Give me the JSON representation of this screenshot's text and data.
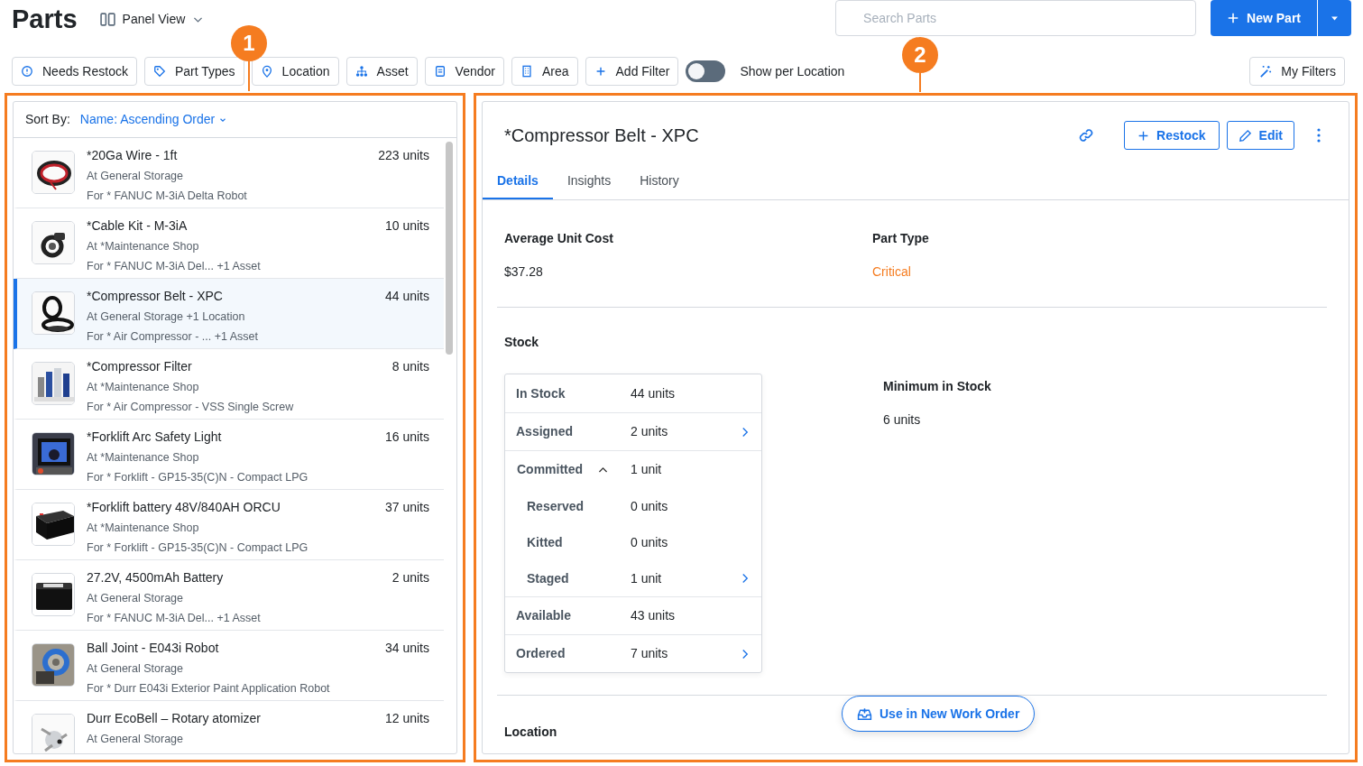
{
  "page": {
    "title": "Parts",
    "view": "Panel View",
    "search": {
      "placeholder": "Search Parts"
    },
    "new_button": "New Part"
  },
  "filters": [
    {
      "label": "Needs Restock",
      "kind": "restock"
    },
    {
      "label": "Part Types",
      "kind": "tag"
    },
    {
      "label": "Location",
      "kind": "pin"
    },
    {
      "label": "Asset",
      "kind": "asset"
    },
    {
      "label": "Vendor",
      "kind": "vendor"
    },
    {
      "label": "Area",
      "kind": "building"
    },
    {
      "label": "Add Filter",
      "kind": "plus"
    }
  ],
  "per_location": {
    "label": "Show per Location",
    "on": false
  },
  "my_filters": "My Filters",
  "sort": {
    "label": "Sort By:",
    "value": "Name: Ascending Order"
  },
  "parts": [
    {
      "name": "*20Ga Wire - 1ft",
      "qty": "223 units",
      "location": "At General Storage",
      "asset": "For * FANUC M-3iA Delta Robot",
      "selected": false
    },
    {
      "name": "*Cable Kit - M-3iA",
      "qty": "10 units",
      "location": "At *Maintenance Shop",
      "asset": "For * FANUC M-3iA Del...  +1 Asset",
      "selected": false
    },
    {
      "name": "*Compressor Belt - XPC",
      "qty": "44 units",
      "location": "At General Storage +1 Location",
      "asset": "For * Air Compressor - ...  +1 Asset",
      "selected": true
    },
    {
      "name": "*Compressor Filter",
      "qty": "8 units",
      "location": "At *Maintenance Shop",
      "asset": "For * Air Compressor - VSS Single Screw",
      "selected": false
    },
    {
      "name": "*Forklift Arc Safety Light",
      "qty": "16 units",
      "location": "At *Maintenance Shop",
      "asset": "For * Forklift - GP15-35(C)N - Compact LPG",
      "selected": false
    },
    {
      "name": "*Forklift battery 48V/840AH ORCU",
      "qty": "37 units",
      "location": "At *Maintenance Shop",
      "asset": "For * Forklift - GP15-35(C)N - Compact LPG",
      "selected": false
    },
    {
      "name": "27.2V, 4500mAh Battery",
      "qty": "2 units",
      "location": "At General Storage",
      "asset": "For * FANUC M-3iA Del...  +1 Asset",
      "selected": false
    },
    {
      "name": "Ball Joint - E043i Robot",
      "qty": "34 units",
      "location": "At General Storage",
      "asset": "For * Durr E043i Exterior Paint Application Robot",
      "selected": false
    },
    {
      "name": "Durr EcoBell – Rotary atomizer",
      "qty": "12 units",
      "location": "At General Storage",
      "selected": false
    }
  ],
  "detail": {
    "title": "*Compressor Belt - XPC",
    "restock": "Restock",
    "edit": "Edit",
    "tabs": [
      {
        "label": "Details",
        "selected": true
      },
      {
        "label": "Insights",
        "selected": false
      },
      {
        "label": "History",
        "selected": false
      }
    ],
    "fields": [
      {
        "label": "Average Unit Cost",
        "value": "$37.28",
        "kind": "plain"
      },
      {
        "label": "Part Type",
        "value": "Critical",
        "kind": "critical"
      }
    ],
    "stock_title": "Stock",
    "stock": [
      {
        "label": "In Stock",
        "value": "44 units",
        "link": false
      },
      {
        "label": "Assigned",
        "value": "2 units",
        "link": true
      },
      {
        "label": "Committed",
        "value": "1 unit",
        "link": false,
        "expanded": true,
        "children": [
          {
            "label": "Reserved",
            "value": "0 units",
            "link": false
          },
          {
            "label": "Kitted",
            "value": "0 units",
            "link": false
          },
          {
            "label": "Staged",
            "value": "1 unit",
            "link": true
          }
        ]
      },
      {
        "label": "Available",
        "value": "43 units",
        "link": false
      },
      {
        "label": "Ordered",
        "value": "7 units",
        "link": true
      }
    ],
    "minimum": {
      "label": "Minimum in Stock",
      "value": "6 units"
    },
    "location_title": "Location",
    "work_order": "Use in New Work Order"
  },
  "callouts": [
    {
      "label": "1"
    },
    {
      "label": "2"
    }
  ]
}
